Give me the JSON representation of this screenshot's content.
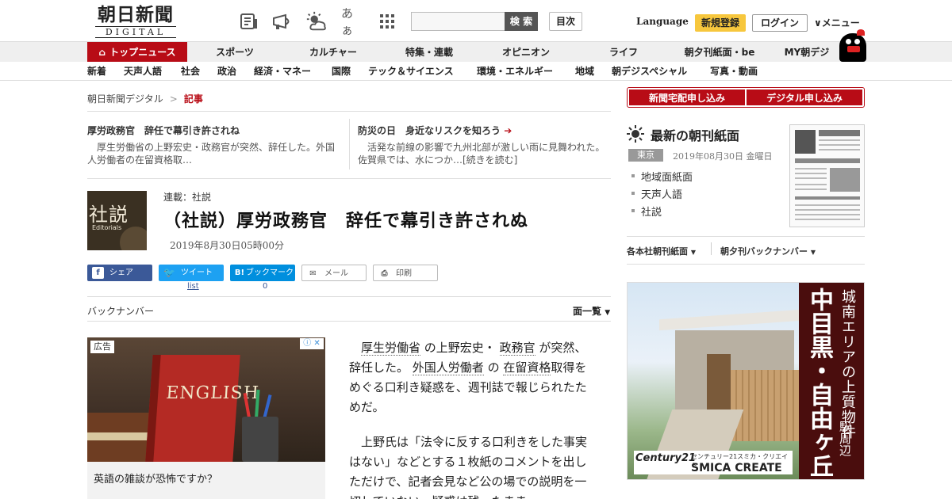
{
  "header": {
    "logo_jp": "朝日新聞",
    "logo_en": "DIGITAL",
    "icons": [
      "newspaper-icon",
      "megaphone-icon",
      "weather-icon",
      "font-size-icon",
      "grid-icon"
    ],
    "font_size_label": "あぁ",
    "search_button": "検 索",
    "toc_button": "目次",
    "language": "Language",
    "register": "新規登録",
    "login": "ログイン",
    "menu": "メニュー"
  },
  "nav1": [
    "トップニュース",
    "スポーツ",
    "カルチャー",
    "特集・連載",
    "オピニオン",
    "ライフ",
    "朝夕刊紙面・be",
    "MY朝デジ"
  ],
  "nav2": [
    "新着",
    "天声人語",
    "社会",
    "政治",
    "経済・マネー",
    "国際",
    "テック＆サイエンス",
    "環境・エネルギー",
    "地域",
    "朝デジスペシャル",
    "写真・動画"
  ],
  "breadcrumb": {
    "home": "朝日新聞デジタル",
    "sep": ">",
    "current": "記事"
  },
  "teasers": [
    {
      "title": "厚労政務官　辞任で幕引き許されね",
      "text_1": "　厚生労働省の上野宏史・政務官が突然、辞任した。外国",
      "text_2": "人労働者の在留資格取…"
    },
    {
      "title": "防災の日　身近なリスクを知ろう",
      "arrow": "➔",
      "text_1": "　活発な前線の影響で九州北部が激しい雨に見舞われた。",
      "text_2": "佐賀県では、水につか…[続きを読む]"
    }
  ],
  "article": {
    "image_jp": "社説",
    "image_en": "Editorials",
    "series": "連載：社説",
    "headline": "（社説）厚労政務官　辞任で幕引き許されぬ",
    "date": "2019年8月30日05時00分"
  },
  "share": {
    "facebook": "シェア",
    "twitter": "ツイート",
    "hatena": "ブックマーク",
    "mail": "メール",
    "print": "印刷",
    "twitter_count": "list",
    "hatena_count": "0"
  },
  "backnumber": {
    "label": "バックナンバー",
    "list": "面一覧"
  },
  "ad_left": {
    "label": "広告",
    "choices": "ⓘ ✕",
    "book_text": "ENGLISH",
    "caption": "英語の雑談が恐怖ですか？"
  },
  "body": {
    "p1_a": "厚生労働省",
    "p1_b": " の上野宏史・ ",
    "p1_c": "政務官",
    "p1_d": " が突然、辞任した。 ",
    "p1_e": "外国人労働者",
    "p1_f": " の ",
    "p1_g": "在留資格",
    "p1_h": "取得をめぐる口利き疑惑を、週刊誌で報じられたためだ。",
    "p2": "上野氏は「法令に反する口利きをした事実はない」などとする１枚紙のコメントを出しただけで、記者会見など公の場での説明を一切していない。疑惑は残ったまま"
  },
  "sidebar": {
    "btn_home_delivery": "新聞宅配申し込み",
    "btn_digital": "デジタル申し込み",
    "morning_title": "最新の朝刊紙面",
    "region": "東京",
    "paper_date": "2019年08月30日 金曜日",
    "paper_links": [
      "地域面紙面",
      "天声人語",
      "社説"
    ],
    "dropdown_1": "各本社朝刊紙面",
    "dropdown_2": "朝夕刊バックナンバー"
  },
  "ad_right": {
    "vertical_1": "城南エリアの上質物件",
    "vertical_2": "中目黒・自由ヶ丘",
    "vertical_3": "駅周辺",
    "logo_c21": "Century21",
    "logo_jp": "センチュリー21スミカ・クリエイト",
    "logo_en": "SMICA CREATE"
  },
  "colors": {
    "brand_red": "#b80c16",
    "register_yellow": "#f7c73d",
    "facebook": "#3b5998",
    "twitter": "#1da1f2",
    "hatena": "#008fde"
  }
}
